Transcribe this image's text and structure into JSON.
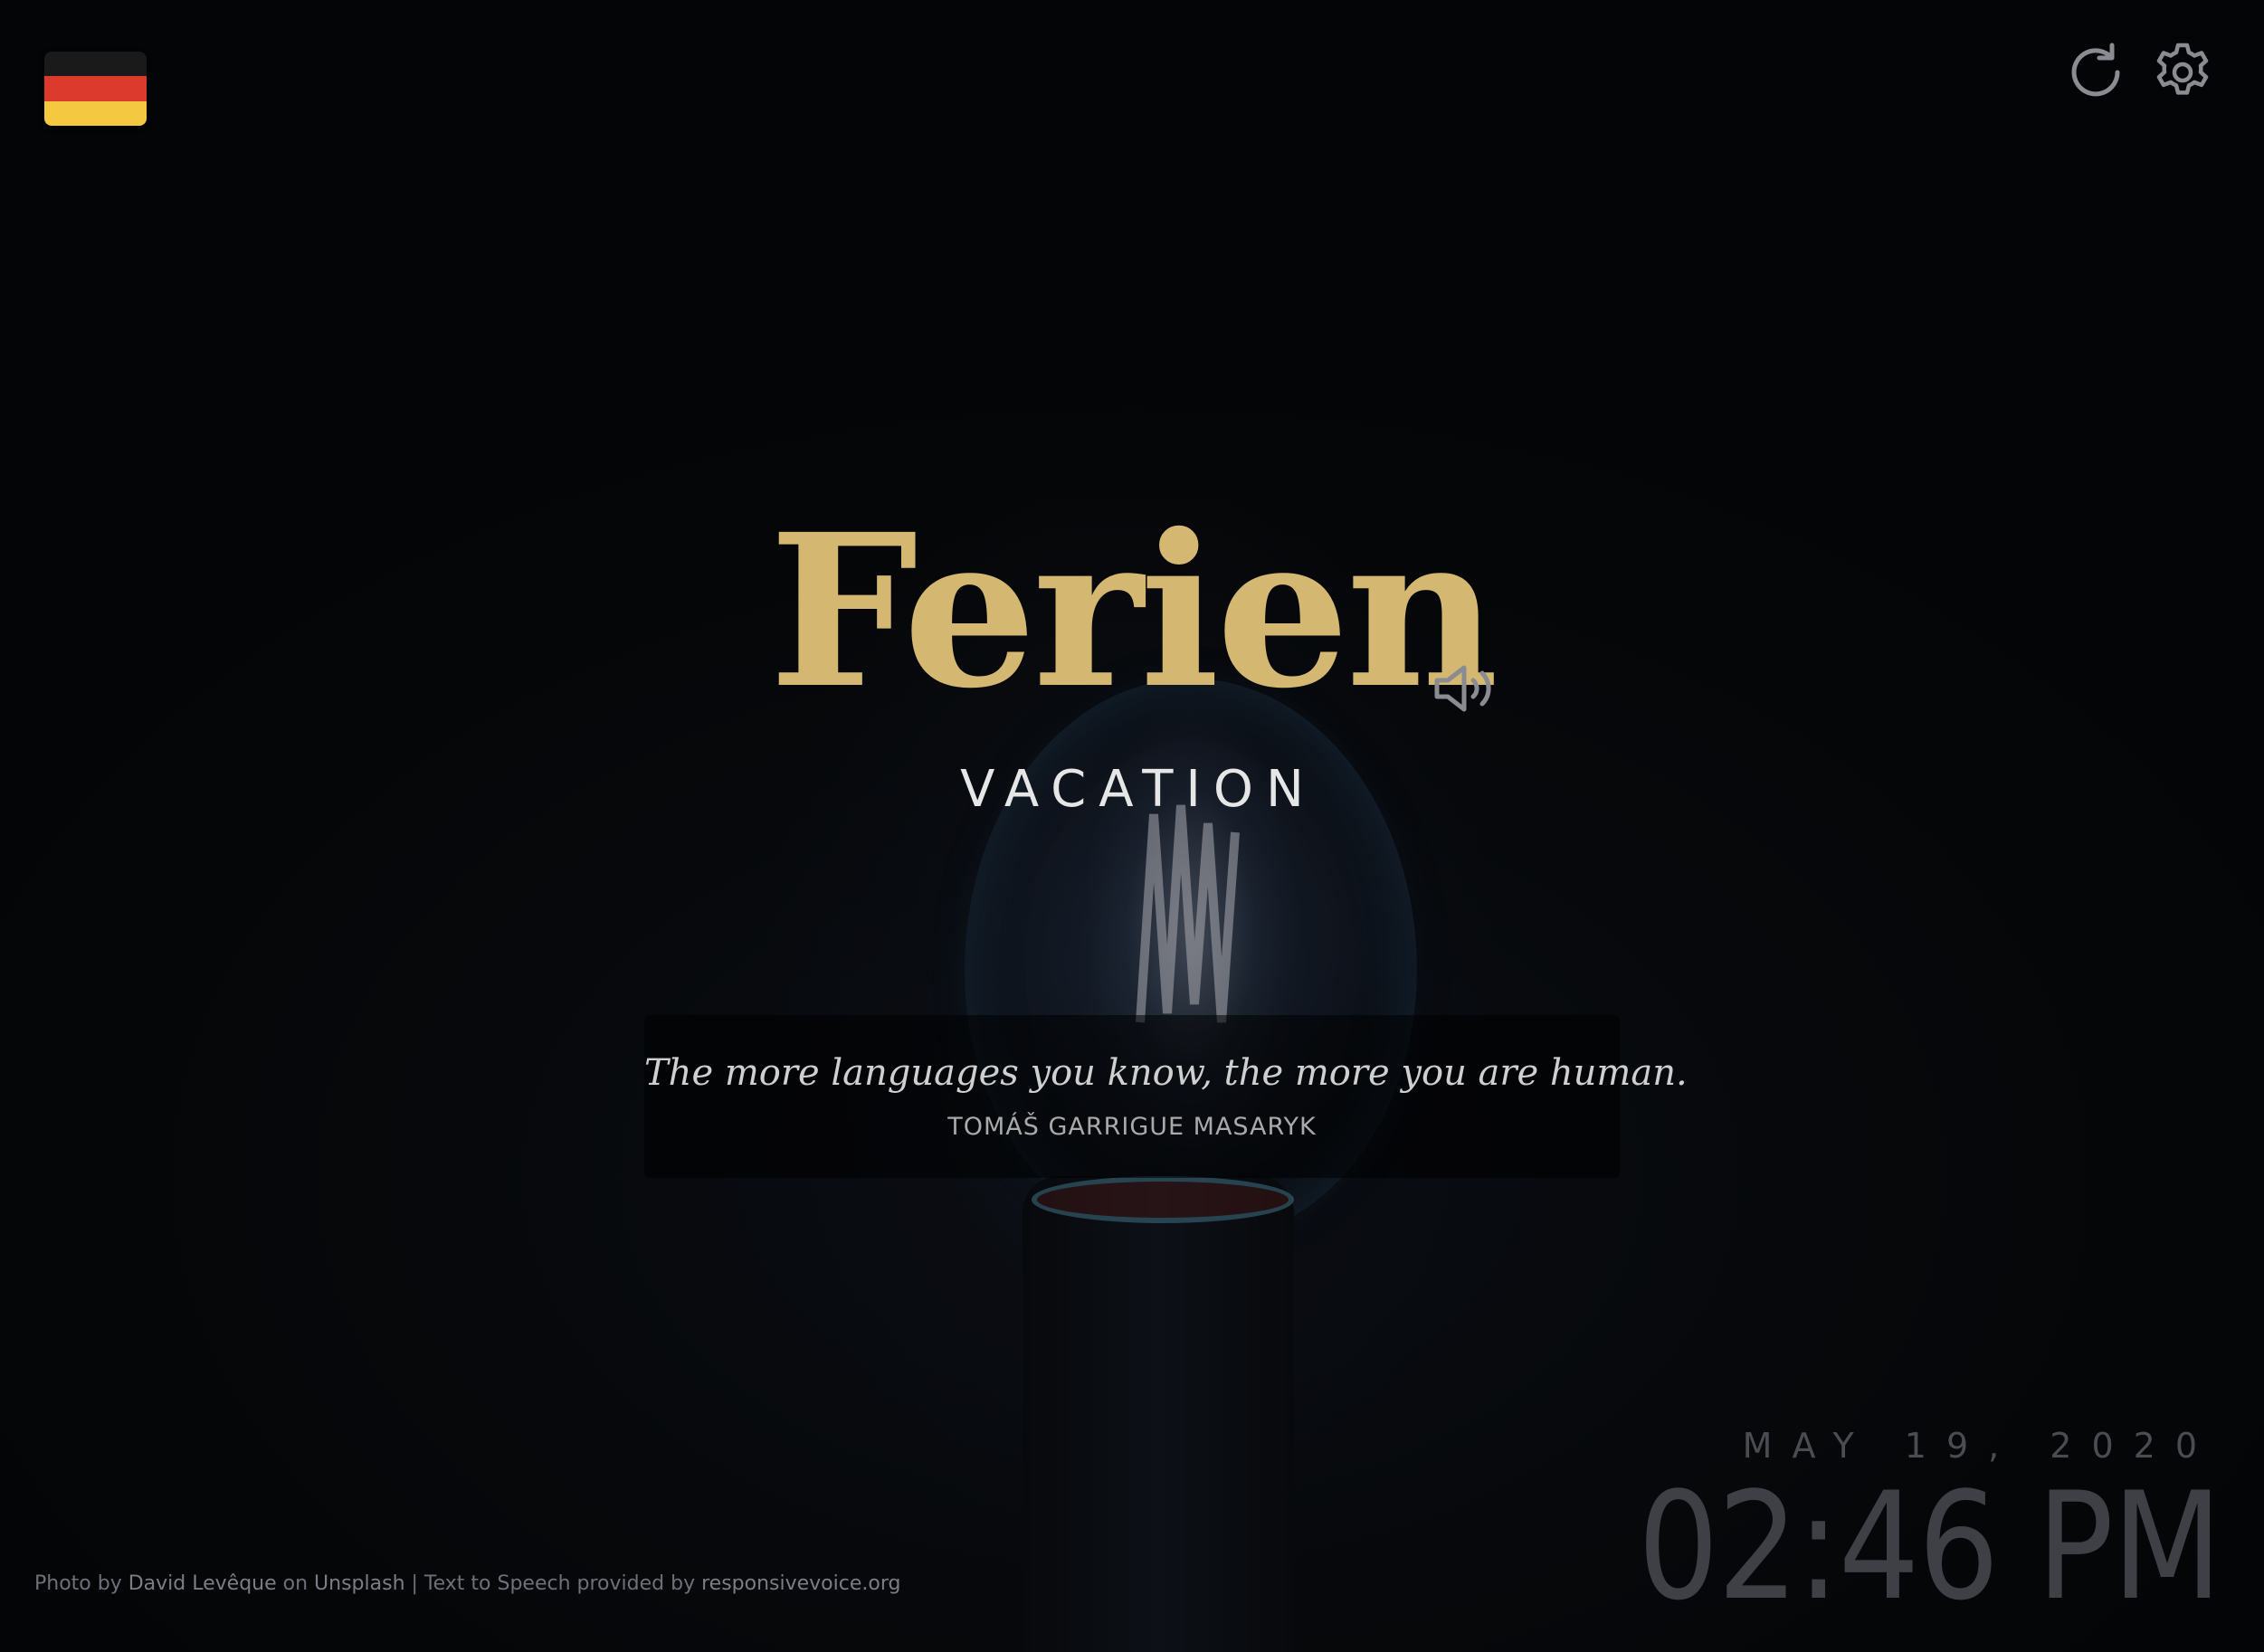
{
  "language": {
    "flag_icon": "germany-flag-icon",
    "flag_colors": [
      "#1a1a1a",
      "#dd3a2e",
      "#f5c842"
    ]
  },
  "toolbar": {
    "refresh_icon": "refresh-icon",
    "settings_icon": "gear-icon",
    "icon_color": "#8a8c92"
  },
  "word": {
    "text": "Ferien",
    "translation": "VACATION",
    "speak_icon": "speaker-icon",
    "accent_color": "#d4b872"
  },
  "quote": {
    "text": "The more languages you know, the more you are human.",
    "author": "TOMÁŠ GARRIGUE MASARYK"
  },
  "credits": {
    "photo_prefix": "Photo by ",
    "photographer": "David Levêque",
    "on": " on ",
    "source": "Unsplash",
    "separator": " | Text to Speech provided by ",
    "tts_provider": "responsivevoice.org"
  },
  "clock": {
    "date": "MAY 19, 2020",
    "time": "02:46 PM"
  }
}
